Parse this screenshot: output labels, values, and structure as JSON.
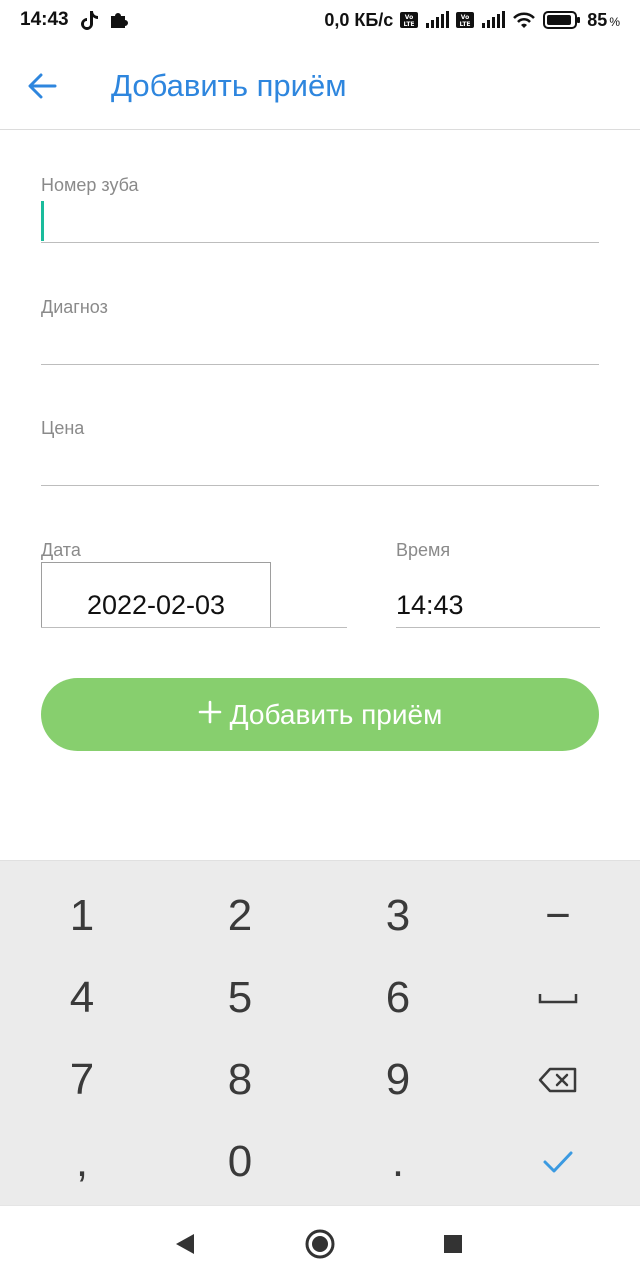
{
  "status_bar": {
    "time": "14:43",
    "speed": "0,0 КБ/с",
    "battery_percent": "85",
    "percent_sign": "%"
  },
  "app_bar": {
    "title": "Добавить приём",
    "back_icon": "arrow-left-icon"
  },
  "form": {
    "tooth_number": {
      "label": "Номер зуба",
      "value": ""
    },
    "diagnosis": {
      "label": "Диагноз",
      "value": ""
    },
    "price": {
      "label": "Цена",
      "value": ""
    },
    "date": {
      "label": "Дата",
      "value": "2022-02-03"
    },
    "time": {
      "label": "Время",
      "value": "14:43"
    },
    "submit_label": "Добавить приём",
    "submit_icon": "plus-icon"
  },
  "keyboard": {
    "keys": [
      "1",
      "2",
      "3",
      "−",
      "4",
      "5",
      "6",
      "space",
      "7",
      "8",
      "9",
      "backspace",
      ",",
      "0",
      ".",
      "done"
    ]
  },
  "colors": {
    "accent": "#2e86de",
    "button": "#87cf6e",
    "cursor": "#1abc9c",
    "keyboard_bg": "#ebebeb"
  }
}
